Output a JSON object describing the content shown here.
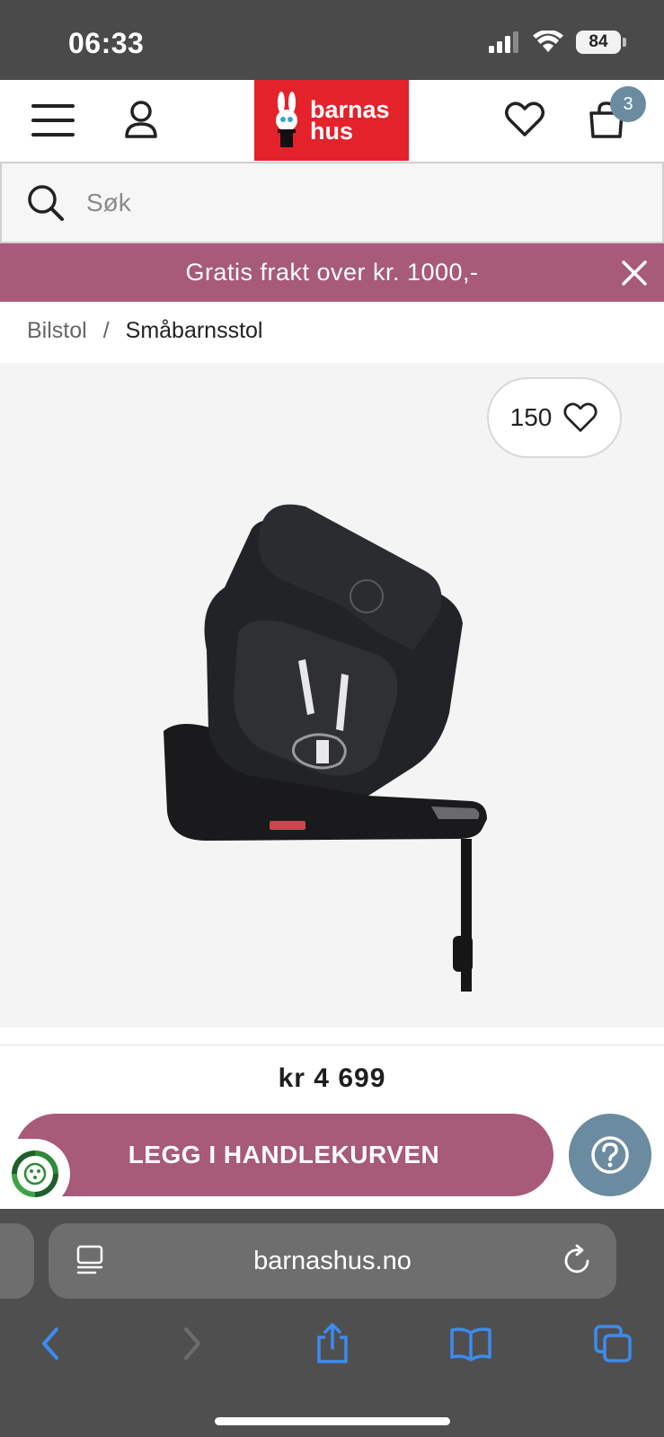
{
  "status": {
    "time": "06:33",
    "battery": "84"
  },
  "header": {
    "logo_line1": "barnas",
    "logo_line2": "hus",
    "cart_count": "3"
  },
  "search": {
    "placeholder": "Søk"
  },
  "promo": {
    "text": "Gratis frakt over kr. 1000,-"
  },
  "breadcrumb": {
    "parent": "Bilstol",
    "separator": "/",
    "current": "Småbarnsstol"
  },
  "product": {
    "favorites_count": "150",
    "price": "kr 4 699",
    "add_to_cart_label": "LEGG I HANDLEKURVEN"
  },
  "browser": {
    "url": "barnashus.no"
  },
  "colors": {
    "accent": "#a85a79",
    "brand_red": "#e4222b",
    "badge_blue": "#6b8ca0",
    "status_bar": "#4a4a4a",
    "browser_chrome": "#4f4f4f",
    "ios_blue": "#3b8cf0"
  },
  "icons": [
    "signal-icon",
    "wifi-icon",
    "battery-icon",
    "menu-icon",
    "user-icon",
    "heart-icon",
    "cart-icon",
    "search-icon",
    "close-icon",
    "eco-icon",
    "help-icon",
    "reader-icon",
    "reload-icon",
    "back-icon",
    "forward-icon",
    "share-icon",
    "bookmarks-icon",
    "tabs-icon"
  ]
}
